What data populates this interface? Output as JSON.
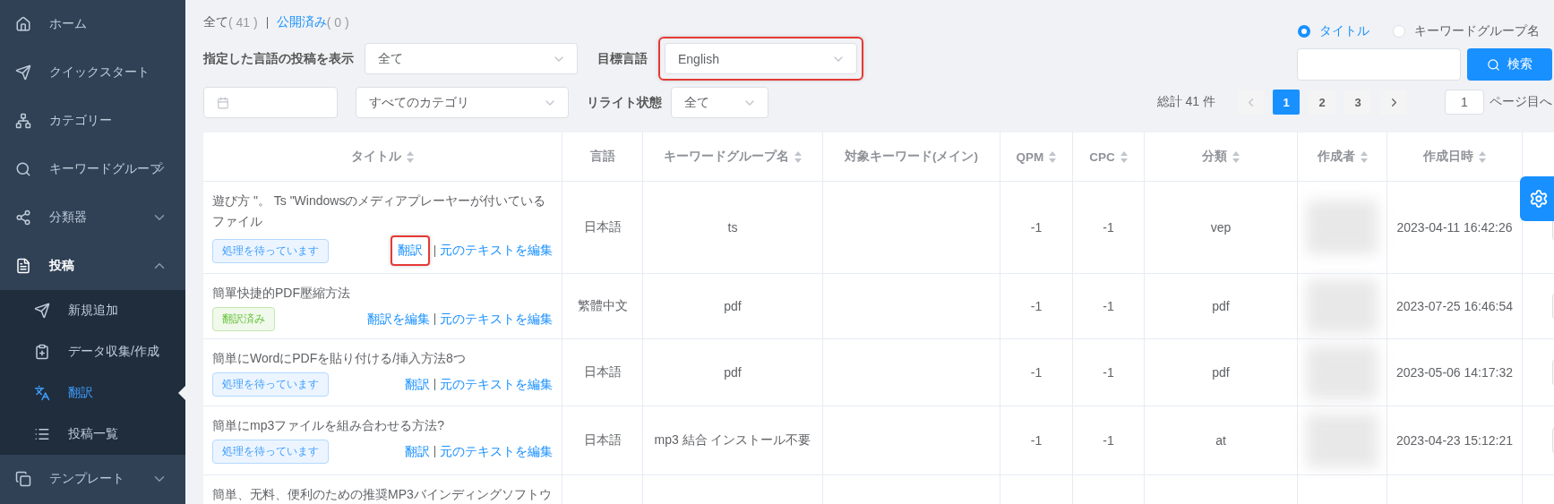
{
  "sidebar": {
    "items": [
      {
        "label": "ホーム"
      },
      {
        "label": "クイックスタート"
      },
      {
        "label": "カテゴリー"
      },
      {
        "label": "キーワードグループ",
        "expanded": false
      },
      {
        "label": "分類器",
        "expanded": false
      },
      {
        "label": "投稿",
        "expanded": true,
        "children": [
          {
            "label": "新規追加",
            "selected": false
          },
          {
            "label": "データ収集/作成",
            "selected": false
          },
          {
            "label": "翻訳",
            "selected": true
          },
          {
            "label": "投稿一覧",
            "selected": false
          }
        ]
      },
      {
        "label": "テンプレート",
        "expanded": false
      }
    ]
  },
  "status_tabs": [
    {
      "label": "全て",
      "count": "( 41 )",
      "selected": false
    },
    {
      "label": "公開済み",
      "count": "( 0 )",
      "selected": true
    }
  ],
  "filters": {
    "source_language": {
      "label": "指定した言語の投稿を表示",
      "value": "全て"
    },
    "target_language": {
      "label": "目標言語",
      "value": "English",
      "highlighted": true
    },
    "category": {
      "value": "すべてのカテゴリ"
    },
    "rewrite_status": {
      "label": "リライト状態",
      "value": "全て"
    }
  },
  "search": {
    "options": [
      {
        "label": "タイトル",
        "selected": true
      },
      {
        "label": "キーワードグループ名",
        "selected": false
      }
    ],
    "button": "検索"
  },
  "pagination": {
    "total": "総計 41 件",
    "pages": [
      {
        "label": "1",
        "selected": true
      },
      {
        "label": "2",
        "selected": false
      },
      {
        "label": "3",
        "selected": false
      }
    ],
    "prev_disabled": true,
    "jump_value": "1",
    "jump_label": "ページ目へ"
  },
  "table": {
    "columns": [
      {
        "label": "タイトル",
        "sortable": true
      },
      {
        "label": "言語",
        "sortable": false
      },
      {
        "label": "キーワードグループ名",
        "sortable": true
      },
      {
        "label": "対象キーワード(メイン)",
        "sortable": false
      },
      {
        "label": "QPM",
        "sortable": true
      },
      {
        "label": "CPC",
        "sortable": true
      },
      {
        "label": "分類",
        "sortable": true
      },
      {
        "label": "作成者",
        "sortable": true
      },
      {
        "label": "作成日時",
        "sortable": true
      }
    ],
    "rows": [
      {
        "title": "遊び方 \"。 Ts \"Windowsのメディアプレーヤーが付いているファイル",
        "status": {
          "label": "処理を待っています",
          "kind": "pending"
        },
        "actions": [
          {
            "label": "翻訳",
            "highlighted": true
          },
          {
            "label": "元のテキストを編集",
            "highlighted": false
          }
        ],
        "language": "日本語",
        "keyword_group": "ts",
        "qpm": "-1",
        "cpc": "-1",
        "classification": "vep",
        "created_at": "2023-04-11 16:42:26"
      },
      {
        "title": "簡單快捷的PDF壓縮方法",
        "status": {
          "label": "翻訳済み",
          "kind": "done"
        },
        "actions": [
          {
            "label": "翻訳を編集",
            "highlighted": false
          },
          {
            "label": "元のテキストを編集",
            "highlighted": false
          }
        ],
        "language": "繁體中文",
        "keyword_group": "pdf",
        "qpm": "-1",
        "cpc": "-1",
        "classification": "pdf",
        "created_at": "2023-07-25 16:46:54"
      },
      {
        "title": "簡単にWordにPDFを貼り付ける/挿入方法8つ",
        "status": {
          "label": "処理を待っています",
          "kind": "pending"
        },
        "actions": [
          {
            "label": "翻訳",
            "highlighted": false
          },
          {
            "label": "元のテキストを編集",
            "highlighted": false
          }
        ],
        "language": "日本語",
        "keyword_group": "pdf",
        "qpm": "-1",
        "cpc": "-1",
        "classification": "pdf",
        "created_at": "2023-05-06 14:17:32"
      },
      {
        "title": "簡単にmp3ファイルを組み合わせる方法?",
        "status": {
          "label": "処理を待っています",
          "kind": "pending"
        },
        "actions": [
          {
            "label": "翻訳",
            "highlighted": false
          },
          {
            "label": "元のテキストを編集",
            "highlighted": false
          }
        ],
        "language": "日本語",
        "keyword_group": "mp3 結合 インストール不要",
        "qpm": "-1",
        "cpc": "-1",
        "classification": "at",
        "created_at": "2023-04-23 15:12:21"
      },
      {
        "title": "簡単、无料、便利のための推奨MP3バインディングソフトウ"
      }
    ]
  }
}
